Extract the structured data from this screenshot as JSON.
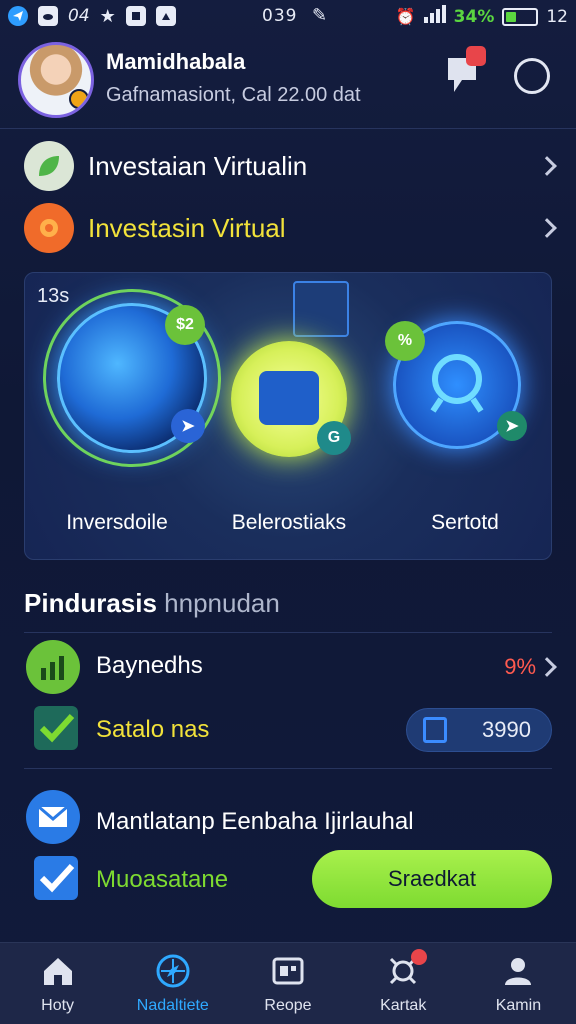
{
  "status_bar": {
    "left_text": "04",
    "time": "039",
    "battery_pct": "34%",
    "battery_level": 0.34,
    "clock": "12"
  },
  "header": {
    "user_name": "Mamidhabala",
    "user_subtitle": "Gafnamasiont, Cal 22.00 dat"
  },
  "menu": [
    {
      "label": "Investaian Virtualin",
      "label_color": "#ffffff",
      "icon_color": "#dbe6d6",
      "icon": "leaf-icon"
    },
    {
      "label": "Investasin Virtual",
      "label_color": "#f2e23a",
      "icon_color": "#f06b2a",
      "icon": "flower-icon"
    }
  ],
  "hero": {
    "tag": "13s",
    "items": [
      {
        "label": "Inversdoile",
        "badge": "$2"
      },
      {
        "label": "Belerostiaks",
        "badge": "G"
      },
      {
        "label": "Sertotd",
        "badge": "%"
      }
    ]
  },
  "section": {
    "title": "Pindurasis",
    "subtitle": "hnpnudan"
  },
  "stats": [
    {
      "label": "Baynedhs",
      "value": "9%",
      "icon": "bar-chart-icon"
    },
    {
      "label": "Satalo nas",
      "value": "3990",
      "icon": "check-icon"
    }
  ],
  "notices": [
    {
      "label": "Mantlatanp Eenbaha Ijirlauhal",
      "icon": "mail-icon"
    },
    {
      "label": "Muoasatane",
      "icon": "check-icon"
    }
  ],
  "cta": {
    "label": "Sraedkat"
  },
  "bottom_nav": [
    {
      "label": "Hoty",
      "icon": "home-icon"
    },
    {
      "label": "Nadaltiete",
      "icon": "compass-icon",
      "active": true
    },
    {
      "label": "Reope",
      "icon": "card-icon"
    },
    {
      "label": "Kartak",
      "icon": "network-icon"
    },
    {
      "label": "Kamin",
      "icon": "user-icon"
    }
  ],
  "colors": {
    "background": "#141d3f",
    "accent_green": "#7edb31",
    "accent_blue": "#2fa9ff",
    "alert_red": "#ff5a4f",
    "yellow_text": "#f2e23a"
  }
}
